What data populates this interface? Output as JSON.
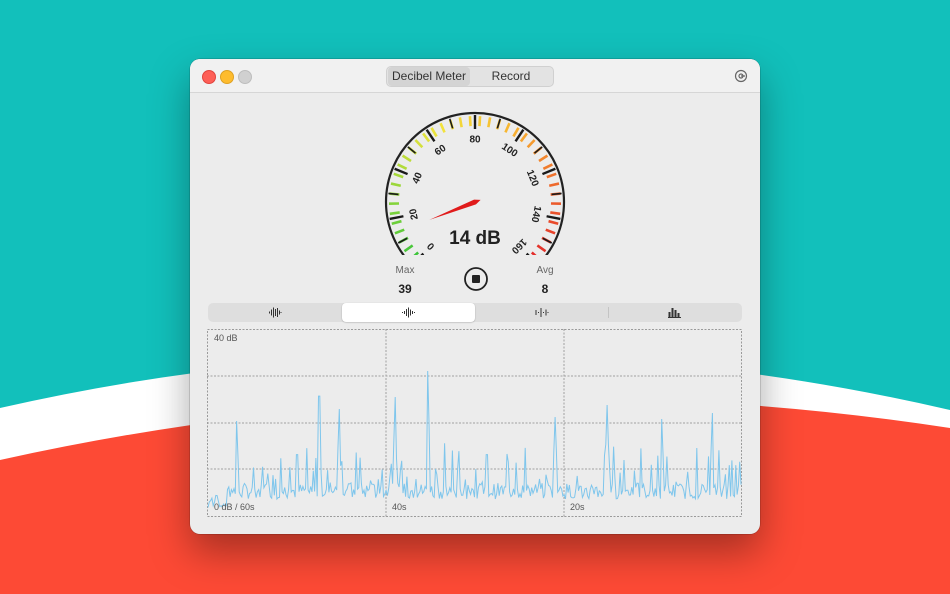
{
  "titlebar": {
    "tabs": [
      {
        "label": "Decibel Meter",
        "active": true
      },
      {
        "label": "Record",
        "active": false
      }
    ],
    "settings_icon": "gear-icon"
  },
  "gauge": {
    "value": 14,
    "min": 0,
    "max": 160,
    "reading": "14 dB",
    "ticks": [
      "0",
      "20",
      "40",
      "60",
      "80",
      "100",
      "120",
      "140",
      "160"
    ]
  },
  "stats": {
    "max_label": "Max",
    "max_value": "39",
    "avg_label": "Avg",
    "avg_value": "8"
  },
  "controls": {
    "stop_icon": "stop-icon"
  },
  "view_modes": [
    {
      "icon": "waveform-icon",
      "active": false
    },
    {
      "icon": "waveform-wide-icon",
      "active": true
    },
    {
      "icon": "waveform-sparse-icon",
      "active": false
    },
    {
      "icon": "bar-chart-icon",
      "active": false
    }
  ],
  "graph": {
    "top_label": "40 dB",
    "bottom_left_label": "0 dB / 60s",
    "time_labels": [
      "40s",
      "20s"
    ],
    "line_color": "#7fc6ec"
  },
  "colors": {
    "background_teal": "#12c0bb",
    "background_red": "#fd4a35",
    "needle": "#e01b1b"
  }
}
